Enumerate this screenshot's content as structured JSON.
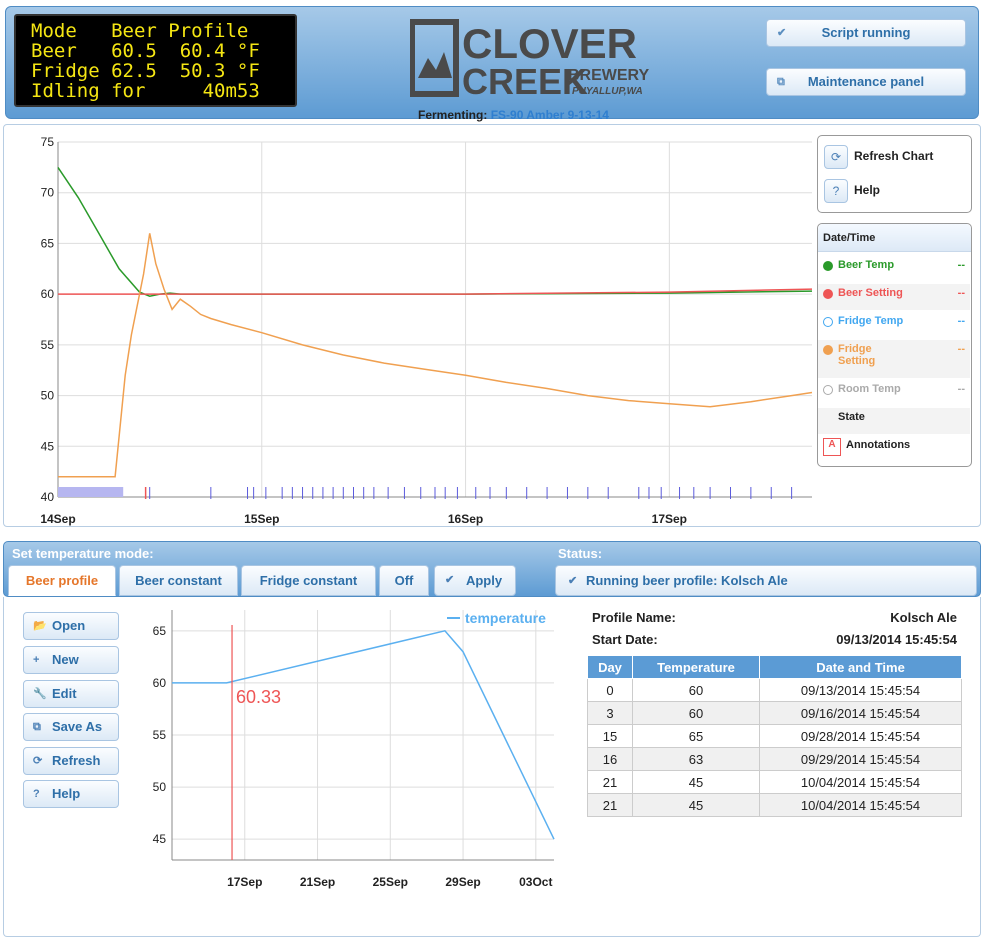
{
  "lcd": {
    "lines": [
      "Mode   Beer Profile",
      "Beer   60.5  60.4 °F",
      "Fridge 62.5  50.3 °F",
      "Idling for     40m53"
    ]
  },
  "logo": {
    "word1": "CLOVER",
    "word2": "CREEK",
    "word3": "BREWERY",
    "word4": "PUYALLUP,WA"
  },
  "header": {
    "script_status": "Script running",
    "maintenance": "Maintenance panel",
    "fermenting_label": "Fermenting:",
    "fermenting_value": "FS-90 Amber 9-13-14"
  },
  "chart_controls": {
    "refresh": "Refresh Chart",
    "help": "Help"
  },
  "legend": {
    "header": "Date/Time",
    "items": [
      {
        "label": "Beer Temp",
        "value": "--",
        "color": "#2a9a2a",
        "filled": true
      },
      {
        "label": "Beer Setting",
        "value": "--",
        "color": "#e55",
        "filled": true
      },
      {
        "label": "Fridge Temp",
        "value": "--",
        "color": "#41a7f0",
        "filled": false
      },
      {
        "label": "Fridge Setting",
        "value": "--",
        "color": "#f0a050",
        "filled": true
      },
      {
        "label": "Room Temp",
        "value": "--",
        "color": "#aaa",
        "filled": false
      },
      {
        "label": "State",
        "value": ""
      },
      {
        "label": "Annotations",
        "value": "",
        "icon": "A"
      }
    ]
  },
  "chart_data": [
    {
      "type": "line",
      "ylim": [
        40,
        75
      ],
      "yticks": [
        "75",
        "70",
        "65",
        "60",
        "55",
        "50",
        "45",
        "40"
      ],
      "xticks": [
        "14Sep",
        "15Sep",
        "16Sep",
        "17Sep"
      ],
      "series": [
        {
          "name": "Beer Temp",
          "color": "#2a9a2a",
          "x_days": [
            0,
            0.1,
            0.2,
            0.3,
            0.4,
            0.45,
            0.5,
            0.55,
            0.6,
            0.7,
            1.0,
            2.0,
            3.0,
            3.7
          ],
          "y": [
            72.5,
            69.5,
            66.0,
            62.5,
            60.2,
            59.8,
            60.0,
            60.1,
            60.0,
            60.0,
            60.0,
            60.0,
            60.1,
            60.3
          ]
        },
        {
          "name": "Beer Setting",
          "color": "#e55",
          "x_days": [
            0,
            1.0,
            2.0,
            3.0,
            3.7
          ],
          "y": [
            60.0,
            60.0,
            60.0,
            60.2,
            60.5
          ]
        },
        {
          "name": "Fridge Setting",
          "color": "#f0a050",
          "x_days": [
            0,
            0.28,
            0.33,
            0.36,
            0.42,
            0.45,
            0.48,
            0.52,
            0.56,
            0.6,
            0.65,
            0.7,
            0.75,
            0.85,
            1.0,
            1.2,
            1.4,
            1.6,
            1.8,
            2.0,
            2.2,
            2.4,
            2.6,
            2.8,
            3.0,
            3.2,
            3.4,
            3.6,
            3.7
          ],
          "y": [
            42.0,
            42.0,
            52.0,
            56.0,
            62.0,
            66.0,
            63.0,
            60.5,
            58.5,
            59.5,
            58.8,
            58.0,
            57.6,
            57.0,
            56.2,
            55.0,
            54.0,
            53.2,
            52.6,
            52.0,
            51.3,
            50.7,
            50.0,
            49.5,
            49.2,
            48.9,
            49.4,
            50.0,
            50.3
          ]
        }
      ]
    },
    {
      "type": "line",
      "ylim": [
        43,
        67
      ],
      "yticks": [
        "65",
        "60",
        "55",
        "50",
        "45"
      ],
      "xticks": [
        "17Sep",
        "21Sep",
        "25Sep",
        "29Sep",
        "03Oct"
      ],
      "series": [
        {
          "name": "temperature",
          "color": "#5bb0f0",
          "x_days": [
            0,
            3,
            15,
            16,
            21
          ],
          "y": [
            60,
            60,
            65,
            63,
            45
          ]
        }
      ],
      "marker": {
        "label": "60.33",
        "x_days": 3.3
      }
    }
  ],
  "mode": {
    "label": "Set temperature mode:",
    "tabs": [
      "Beer profile",
      "Beer constant",
      "Fridge constant",
      "Off"
    ],
    "apply": "Apply",
    "status_label": "Status:",
    "status_value": "Running beer profile: Kolsch Ale"
  },
  "profile_buttons": [
    "Open",
    "New",
    "Edit",
    "Save As",
    "Refresh",
    "Help"
  ],
  "profile": {
    "name_label": "Profile Name:",
    "name_value": "Kolsch Ale",
    "start_label": "Start Date:",
    "start_value": "09/13/2014 15:45:54",
    "columns": [
      "Day",
      "Temperature",
      "Date and Time"
    ],
    "rows": [
      [
        "0",
        "60",
        "09/13/2014 15:45:54"
      ],
      [
        "3",
        "60",
        "09/16/2014 15:45:54"
      ],
      [
        "15",
        "65",
        "09/28/2014 15:45:54"
      ],
      [
        "16",
        "63",
        "09/29/2014 15:45:54"
      ],
      [
        "21",
        "45",
        "10/04/2014 15:45:54"
      ],
      [
        "21",
        "45",
        "10/04/2014 15:45:54"
      ]
    ]
  }
}
